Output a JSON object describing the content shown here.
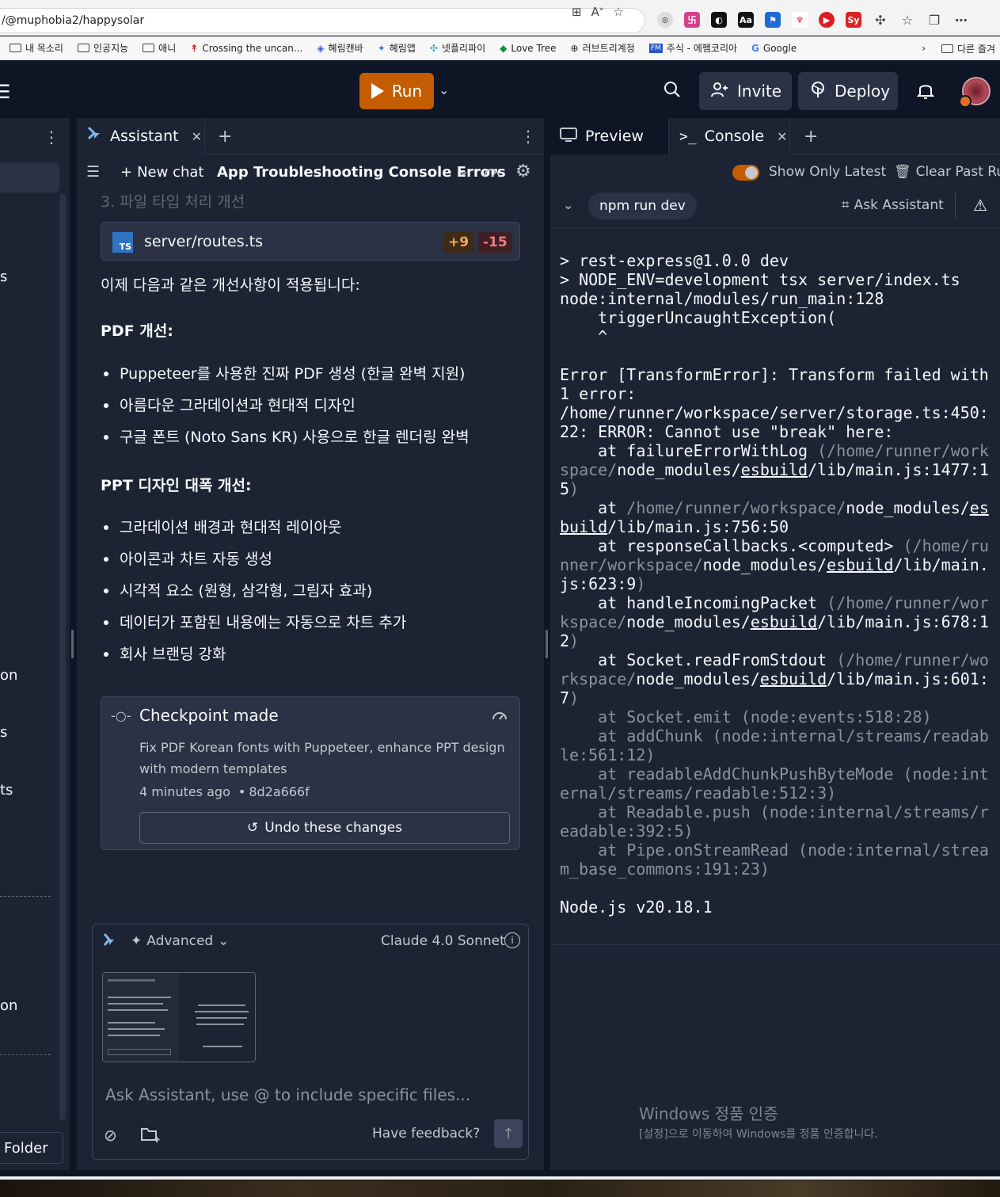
{
  "browser": {
    "url": "/@muphobia2/happysolar",
    "bookmarks": [
      "내 목소리",
      "인공지능",
      "애니",
      "Crossing the uncan...",
      "혜림캔바",
      "혜림앱",
      "넷플리파이",
      "Love Tree",
      "러브트리계정",
      "주식 - 에펨코리아",
      "Google"
    ],
    "bookmarks_more": "다른 즐겨"
  },
  "header": {
    "run_label": "Run",
    "invite_label": "Invite",
    "deploy_label": "Deploy"
  },
  "left_pane": {
    "fragments": [
      "s",
      "on",
      "s",
      "ts",
      "on"
    ],
    "folder_button": "Folder"
  },
  "assistant": {
    "tab_label": "Assistant",
    "new_chat_label": "New chat",
    "chat_title": "App Troubleshooting Console Errors",
    "faded_heading": "3. 파일 타입 처리 개선",
    "file_card": {
      "name": "server/routes.ts",
      "icon_text": "TS",
      "additions": "+9",
      "deletions": "-15"
    },
    "intro": "이제 다음과 같은 개선사항이 적용됩니다:",
    "pdf_heading": "PDF 개선:",
    "pdf_items": [
      "Puppeteer를 사용한 진짜 PDF 생성 (한글 완벽 지원)",
      "아름다운 그라데이션과 현대적 디자인",
      "구글 폰트 (Noto Sans KR) 사용으로 한글 렌더링 완벽"
    ],
    "ppt_heading": "PPT 디자인 대폭 개선:",
    "ppt_items": [
      "그라데이션 배경과 현대적 레이아웃",
      "아이콘과 차트 자동 생성",
      "시각적 요소 (원형, 삼각형, 그림자 효과)",
      "데이터가 포함된 내용에는 자동으로 차트 추가",
      "회사 브랜딩 강화"
    ],
    "checkpoint": {
      "title": "Checkpoint made",
      "description_line1": "Fix PDF Korean fonts with Puppeteer, enhance PPT design",
      "description_line2": "with modern templates",
      "time": "4 minutes ago",
      "hash": "8d2a666f",
      "undo_label": "Undo these changes"
    },
    "input": {
      "mode_label": "Advanced",
      "model_label": "Claude 4.0 Sonnet",
      "placeholder": "Ask Assistant, use @ to include specific files...",
      "feedback_label": "Have feedback?"
    }
  },
  "console": {
    "preview_tab": "Preview",
    "console_tab": "Console",
    "show_only_latest": "Show Only Latest",
    "clear_past_runs": "Clear Past Run",
    "command": "npm run dev",
    "ask_assistant": "Ask Assistant",
    "output": {
      "l1": "> rest-express@1.0.0 dev",
      "l2": "> NODE_ENV=development tsx server/index.ts",
      "l3": "node:internal/modules/run_main:128",
      "l4": "    triggerUncaughtException(",
      "l5": "    ^",
      "l6": "",
      "l7": "Error [TransformError]: Transform failed with 1 error:",
      "l8": "/home/runner/workspace/server/storage.ts:450:22: ERROR: Cannot use \"break\" here:",
      "node_version": "Node.js v20.18.1"
    },
    "stack": [
      {
        "fn": "failureErrorWithLog",
        "dim": "(/home/runner/workspace/",
        "pre": "node_modules/",
        "ul": "esbuild",
        "post": "/lib/main.js:1477:15",
        "close": ")"
      },
      {
        "fn": "",
        "dim": "/home/runner/workspace/",
        "pre": "node_modules/",
        "ul": "esbuild",
        "post": "/lib/main.js:756:50",
        "close": ""
      },
      {
        "fn": "responseCallbacks.<computed>",
        "dim": "(/home/runner/workspace/",
        "pre": "node_modules/",
        "ul": "esbuild",
        "post": "/lib/main.js:623:9",
        "close": ")"
      },
      {
        "fn": "handleIncomingPacket",
        "dim": "(/home/runner/workspace/",
        "pre": "node_modules/",
        "ul": "esbuild",
        "post": "/lib/main.js:678:12",
        "close": ")"
      },
      {
        "fn": "Socket.readFromStdout",
        "dim": "(/home/runner/workspace/",
        "pre": "node_modules/",
        "ul": "esbuild",
        "post": "/lib/main.js:601:7",
        "close": ")"
      }
    ],
    "node_stack": [
      "    at Socket.emit (node:events:518:28)",
      "    at addChunk (node:internal/streams/readable:561:12)",
      "    at readableAddChunkPushByteMode (node:internal/streams/readable:512:3)",
      "    at Readable.push (node:internal/streams/readable:392:5)",
      "    at Pipe.onStreamRead (node:internal/stream_base_commons:191:23)"
    ]
  },
  "watermark": {
    "title": "Windows 정품 인증",
    "subtitle": "[설정]으로 이동하여 Windows를 정품 인증합니다."
  }
}
